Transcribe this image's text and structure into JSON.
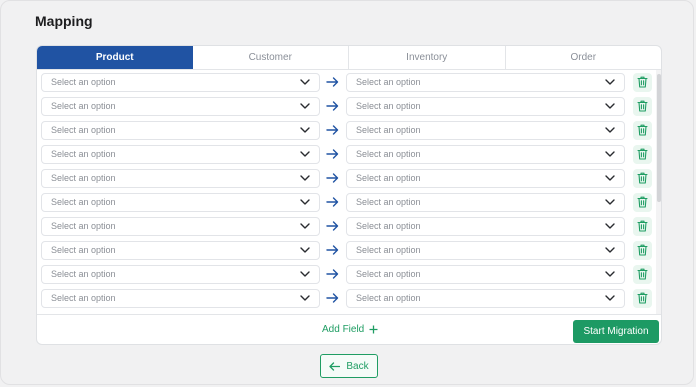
{
  "page": {
    "title": "Mapping"
  },
  "tabs": [
    {
      "label": "Product",
      "active": true
    },
    {
      "label": "Customer",
      "active": false
    },
    {
      "label": "Inventory",
      "active": false
    },
    {
      "label": "Order",
      "active": false
    }
  ],
  "mapping_rows": [
    {
      "source_placeholder": "Select an option",
      "target_placeholder": "Select an option"
    },
    {
      "source_placeholder": "Select an option",
      "target_placeholder": "Select an option"
    },
    {
      "source_placeholder": "Select an option",
      "target_placeholder": "Select an option"
    },
    {
      "source_placeholder": "Select an option",
      "target_placeholder": "Select an option"
    },
    {
      "source_placeholder": "Select an option",
      "target_placeholder": "Select an option"
    },
    {
      "source_placeholder": "Select an option",
      "target_placeholder": "Select an option"
    },
    {
      "source_placeholder": "Select an option",
      "target_placeholder": "Select an option"
    },
    {
      "source_placeholder": "Select an option",
      "target_placeholder": "Select an option"
    },
    {
      "source_placeholder": "Select an option",
      "target_placeholder": "Select an option"
    },
    {
      "source_placeholder": "Select an option",
      "target_placeholder": "Select an option"
    }
  ],
  "icons": {
    "row_arrow": "arrow-right-icon",
    "dropdown": "chevron-down-icon",
    "delete": "trash-icon",
    "add": "plus-icon",
    "back": "arrow-left-icon"
  },
  "footer": {
    "add_field_label": "Add Field",
    "start_migration_label": "Start Migration"
  },
  "back_label": "Back",
  "colors": {
    "active_tab": "#2053a3",
    "accent_green": "#1d9a64",
    "arrow_blue": "#2053a3",
    "trash_bg": "#e9f6ef"
  }
}
